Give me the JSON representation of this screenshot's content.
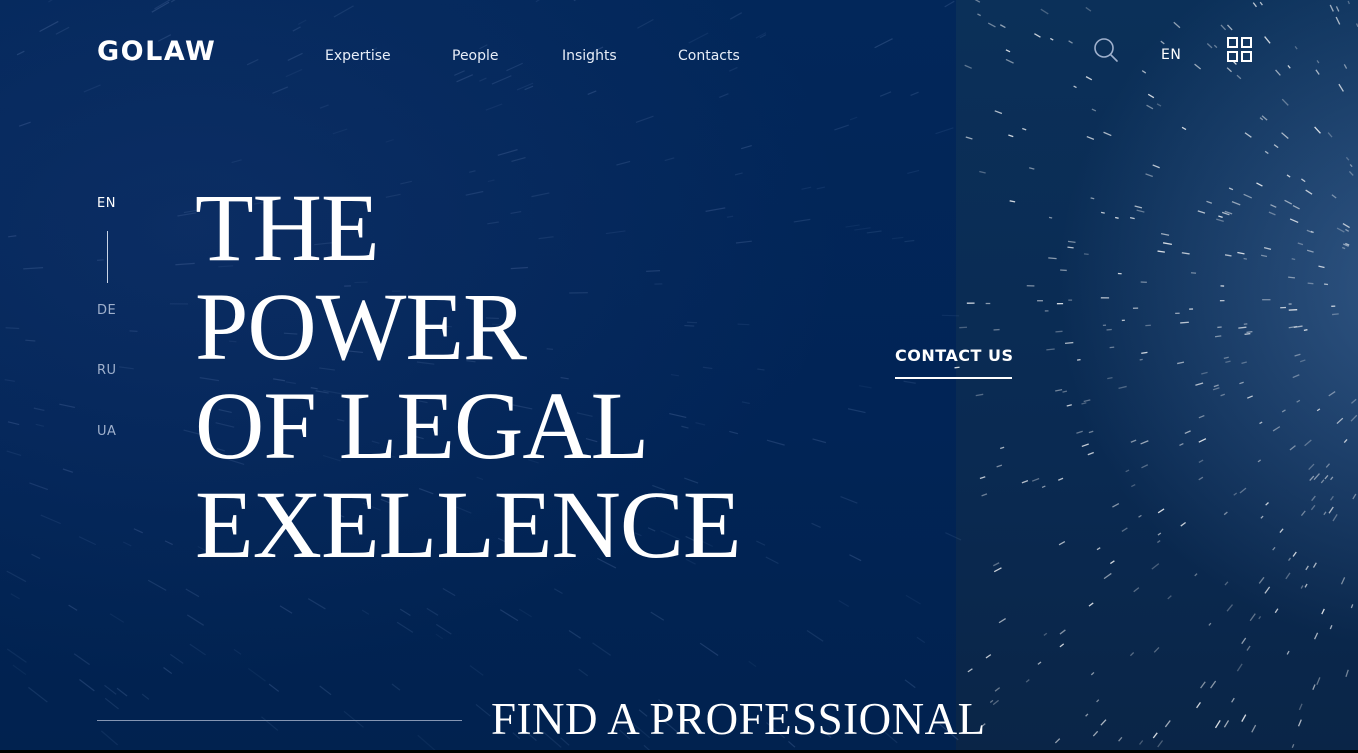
{
  "header": {
    "logo": "GOLAW",
    "nav": [
      {
        "label": "Expertise"
      },
      {
        "label": "People"
      },
      {
        "label": "Insights"
      },
      {
        "label": "Contacts"
      }
    ],
    "language": "EN",
    "icons": [
      "search-icon",
      "grid-menu-icon"
    ]
  },
  "side_languages": {
    "items": [
      {
        "label": "EN",
        "active": true
      },
      {
        "label": "DE",
        "active": false
      },
      {
        "label": "RU",
        "active": false
      },
      {
        "label": "UA",
        "active": false
      }
    ]
  },
  "hero": {
    "lines": [
      "THE",
      "POWER",
      "OF LEGAL",
      "EXELLENCE"
    ],
    "cta": "CONTACT US"
  },
  "find": {
    "title": "FIND A PROFESSIONAL"
  },
  "colors": {
    "background": "#012457",
    "right_panel": "#0a2a52",
    "text": "#ffffff",
    "muted_text": "#9fb0cc"
  }
}
